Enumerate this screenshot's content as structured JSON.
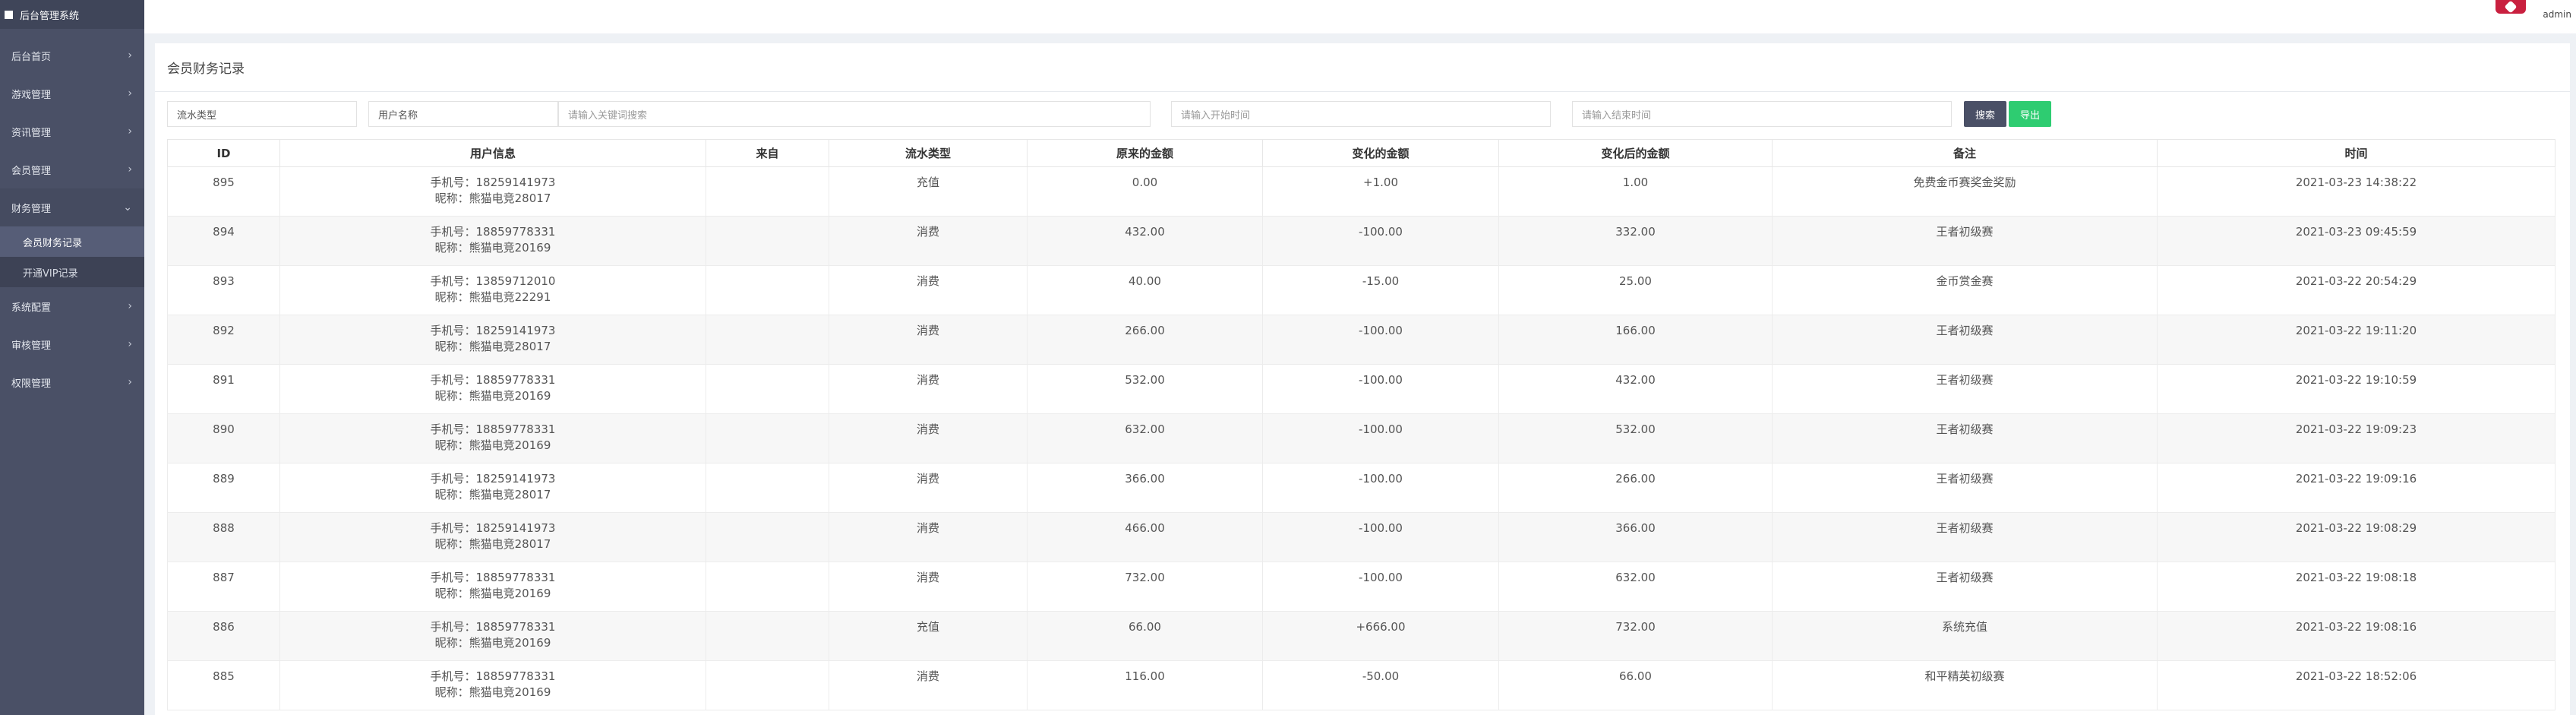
{
  "app": {
    "title": "后台管理系统"
  },
  "header": {
    "username": "admin"
  },
  "sidebar": {
    "items": [
      {
        "label": "后台首页",
        "chevron": "›"
      },
      {
        "label": "游戏管理",
        "chevron": "›"
      },
      {
        "label": "资讯管理",
        "chevron": "›"
      },
      {
        "label": "会员管理",
        "chevron": "›"
      },
      {
        "label": "财务管理",
        "chevron": "⌄"
      },
      {
        "label": "系统配置",
        "chevron": "›"
      },
      {
        "label": "审核管理",
        "chevron": "›"
      },
      {
        "label": "权限管理",
        "chevron": "›"
      }
    ],
    "finance_sub": [
      {
        "label": "会员财务记录"
      },
      {
        "label": "开通VIP记录"
      }
    ]
  },
  "page": {
    "title": "会员财务记录"
  },
  "filters": {
    "type_value": "流水类型",
    "user_value": "用户名称",
    "keyword_placeholder": "请输入关键词搜索",
    "start_placeholder": "请输入开始时间",
    "end_placeholder": "请输入结束时间",
    "search_label": "搜索",
    "export_label": "导出"
  },
  "table": {
    "columns": [
      "ID",
      "用户信息",
      "来自",
      "流水类型",
      "原来的金额",
      "变化的金额",
      "变化后的金额",
      "备注",
      "时间"
    ],
    "rows": [
      {
        "id": "895",
        "phone": "手机号：18259141973",
        "nick": "昵称：熊猫电竞28017",
        "from": "",
        "type": "充值",
        "before": "0.00",
        "change": "+1.00",
        "after": "1.00",
        "note": "免费金币赛奖金奖励",
        "time": "2021-03-23 14:38:22"
      },
      {
        "id": "894",
        "phone": "手机号：18859778331",
        "nick": "昵称：熊猫电竞20169",
        "from": "",
        "type": "消费",
        "before": "432.00",
        "change": "-100.00",
        "after": "332.00",
        "note": "王者初级赛",
        "time": "2021-03-23 09:45:59"
      },
      {
        "id": "893",
        "phone": "手机号：13859712010",
        "nick": "昵称：熊猫电竞22291",
        "from": "",
        "type": "消费",
        "before": "40.00",
        "change": "-15.00",
        "after": "25.00",
        "note": "金币赏金赛",
        "time": "2021-03-22 20:54:29"
      },
      {
        "id": "892",
        "phone": "手机号：18259141973",
        "nick": "昵称：熊猫电竞28017",
        "from": "",
        "type": "消费",
        "before": "266.00",
        "change": "-100.00",
        "after": "166.00",
        "note": "王者初级赛",
        "time": "2021-03-22 19:11:20"
      },
      {
        "id": "891",
        "phone": "手机号：18859778331",
        "nick": "昵称：熊猫电竞20169",
        "from": "",
        "type": "消费",
        "before": "532.00",
        "change": "-100.00",
        "after": "432.00",
        "note": "王者初级赛",
        "time": "2021-03-22 19:10:59"
      },
      {
        "id": "890",
        "phone": "手机号：18859778331",
        "nick": "昵称：熊猫电竞20169",
        "from": "",
        "type": "消费",
        "before": "632.00",
        "change": "-100.00",
        "after": "532.00",
        "note": "王者初级赛",
        "time": "2021-03-22 19:09:23"
      },
      {
        "id": "889",
        "phone": "手机号：18259141973",
        "nick": "昵称：熊猫电竞28017",
        "from": "",
        "type": "消费",
        "before": "366.00",
        "change": "-100.00",
        "after": "266.00",
        "note": "王者初级赛",
        "time": "2021-03-22 19:09:16"
      },
      {
        "id": "888",
        "phone": "手机号：18259141973",
        "nick": "昵称：熊猫电竞28017",
        "from": "",
        "type": "消费",
        "before": "466.00",
        "change": "-100.00",
        "after": "366.00",
        "note": "王者初级赛",
        "time": "2021-03-22 19:08:29"
      },
      {
        "id": "887",
        "phone": "手机号：18859778331",
        "nick": "昵称：熊猫电竞20169",
        "from": "",
        "type": "消费",
        "before": "732.00",
        "change": "-100.00",
        "after": "632.00",
        "note": "王者初级赛",
        "time": "2021-03-22 19:08:18"
      },
      {
        "id": "886",
        "phone": "手机号：18859778331",
        "nick": "昵称：熊猫电竞20169",
        "from": "",
        "type": "充值",
        "before": "66.00",
        "change": "+666.00",
        "after": "732.00",
        "note": "系统充值",
        "time": "2021-03-22 19:08:16"
      },
      {
        "id": "885",
        "phone": "手机号：18859778331",
        "nick": "昵称：熊猫电竞20169",
        "from": "",
        "type": "消费",
        "before": "116.00",
        "change": "-50.00",
        "after": "66.00",
        "note": "和平精英初级赛",
        "time": "2021-03-22 18:52:06"
      }
    ]
  },
  "colors": {
    "sidebar": "#4a5066",
    "accent_green": "#2ecc71",
    "avatar_red": "#c9203f"
  }
}
